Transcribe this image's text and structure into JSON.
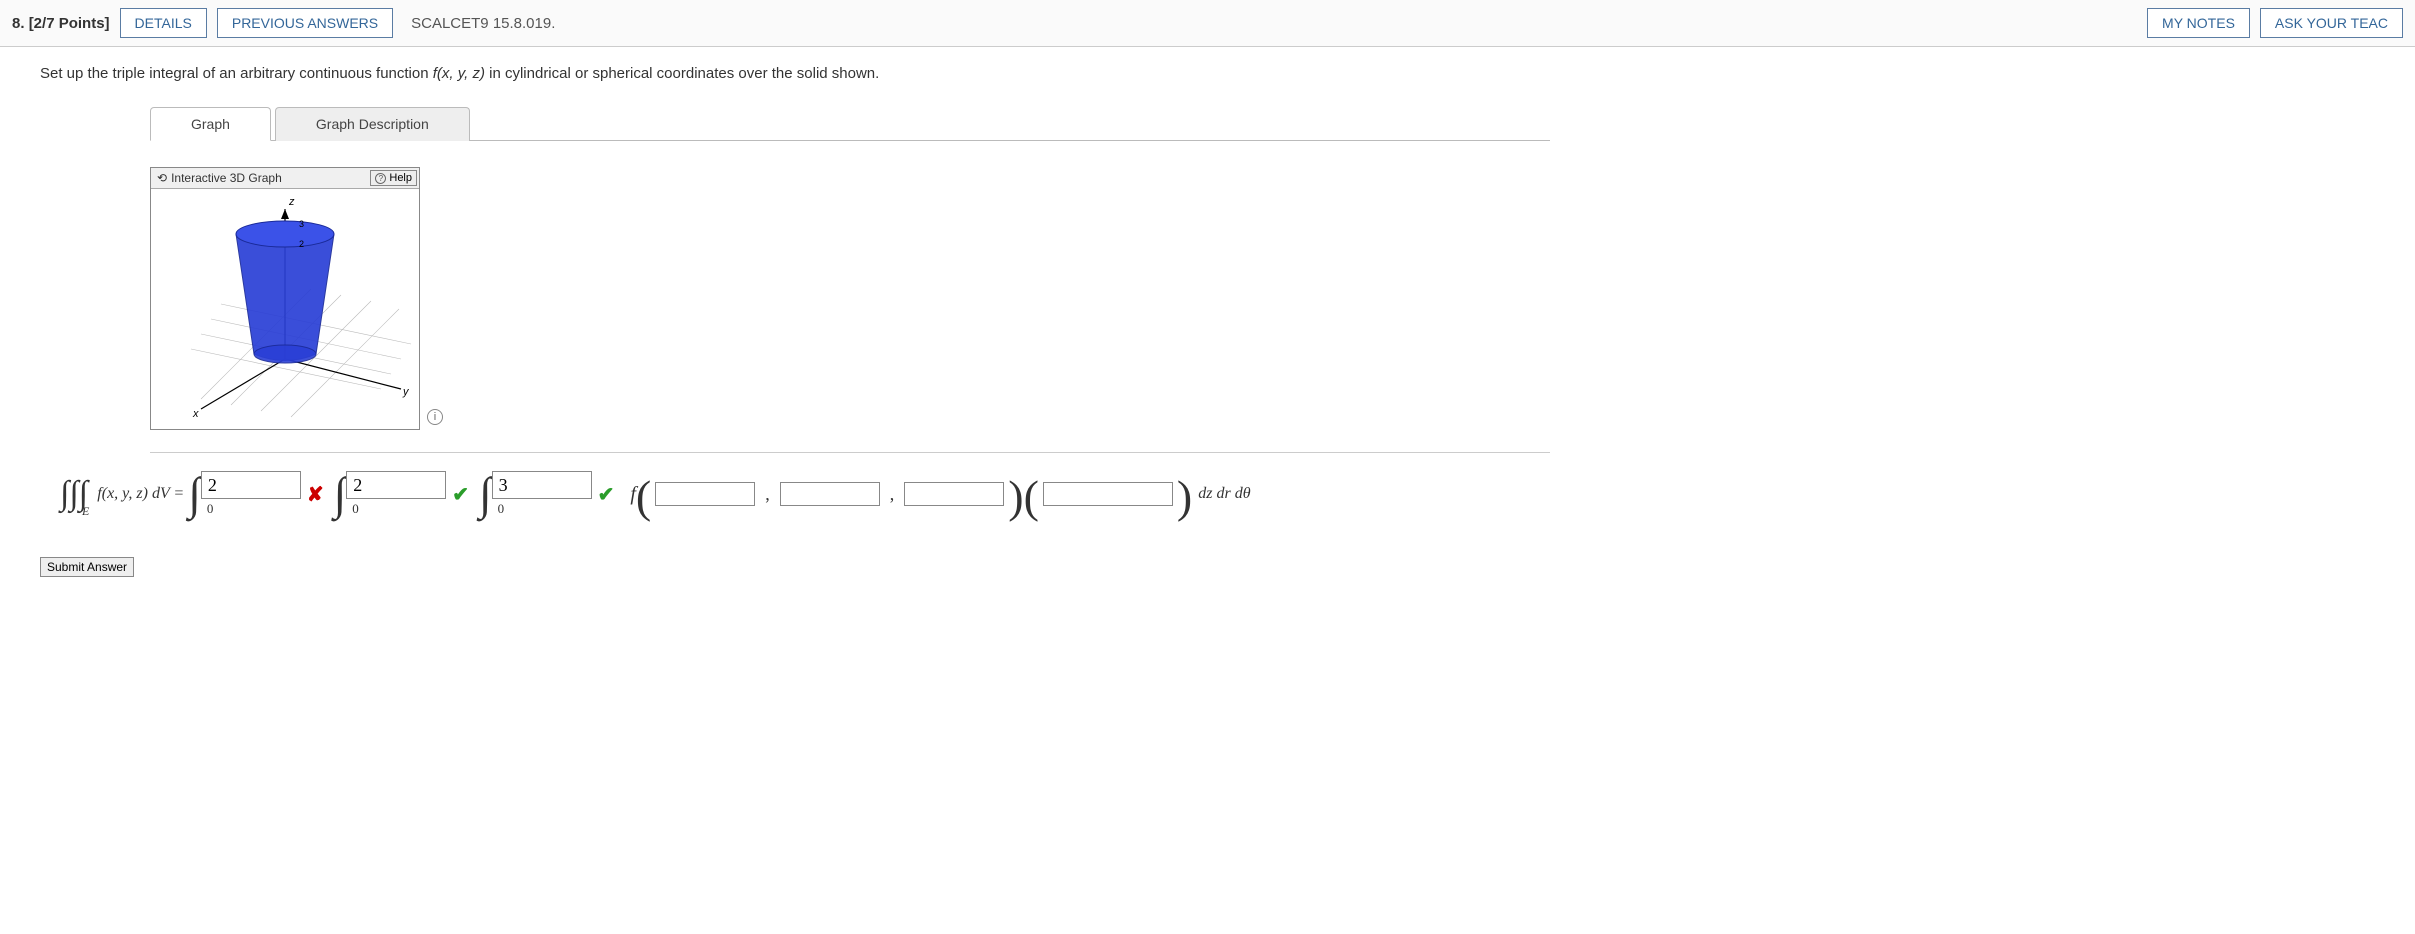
{
  "header": {
    "number": "8.",
    "points": "[2/7 Points]",
    "details": "DETAILS",
    "prev": "PREVIOUS ANSWERS",
    "source": "SCALCET9 15.8.019.",
    "notes": "MY NOTES",
    "ask": "ASK YOUR TEAC"
  },
  "prompt": {
    "pre": "Set up the triple integral of an arbitrary continuous function ",
    "fn": "f(x, y, z)",
    "post": " in cylindrical or spherical coordinates over the solid shown."
  },
  "tabs": {
    "graph": "Graph",
    "desc": "Graph Description"
  },
  "graph": {
    "title": "Interactive 3D Graph",
    "help": "Help",
    "axis_z": "z",
    "axis_y": "y",
    "axis_x": "x"
  },
  "eq": {
    "region": "E",
    "integrand": "f(x, y, z) dV =",
    "upper1": "2",
    "upper2": "2",
    "upper3": "3",
    "lower": "0",
    "f": "f",
    "sep": ",",
    "trail": "dz dr dθ"
  },
  "submit": "Submit Answer"
}
